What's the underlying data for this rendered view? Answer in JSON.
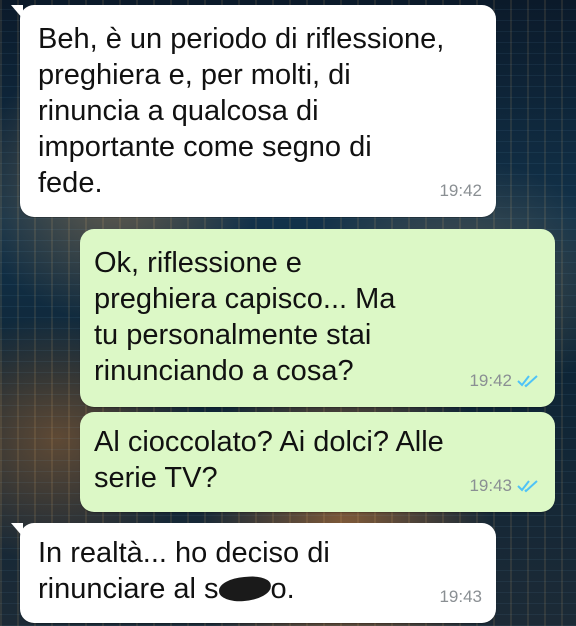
{
  "messages": [
    {
      "direction": "incoming",
      "text": "Beh, è un periodo di riflessione,\npreghiera e, per molti, di\nrinuncia a qualcosa di\nimportante come segno di\nfede.",
      "time": "19:42"
    },
    {
      "direction": "outgoing",
      "text": "Ok, riflessione e\npreghiera capisco... Ma\ntu personalmente stai\nrinunciando a cosa?",
      "time": "19:42",
      "status_icon": "double-check-read-icon"
    },
    {
      "direction": "outgoing",
      "text": "Al cioccolato? Ai dolci? Alle\nserie TV?",
      "time": "19:43",
      "status_icon": "double-check-read-icon"
    },
    {
      "direction": "incoming",
      "text_line1": "In realtà... ho deciso di",
      "text_line2_before": "rinunciare al s",
      "text_line2_after": "o.",
      "time": "19:43"
    }
  ],
  "colors": {
    "incoming_bubble": "#ffffff",
    "outgoing_bubble": "#dcf8c6",
    "read_ticks": "#4fc3f7",
    "timestamp": "#8a8f93"
  }
}
